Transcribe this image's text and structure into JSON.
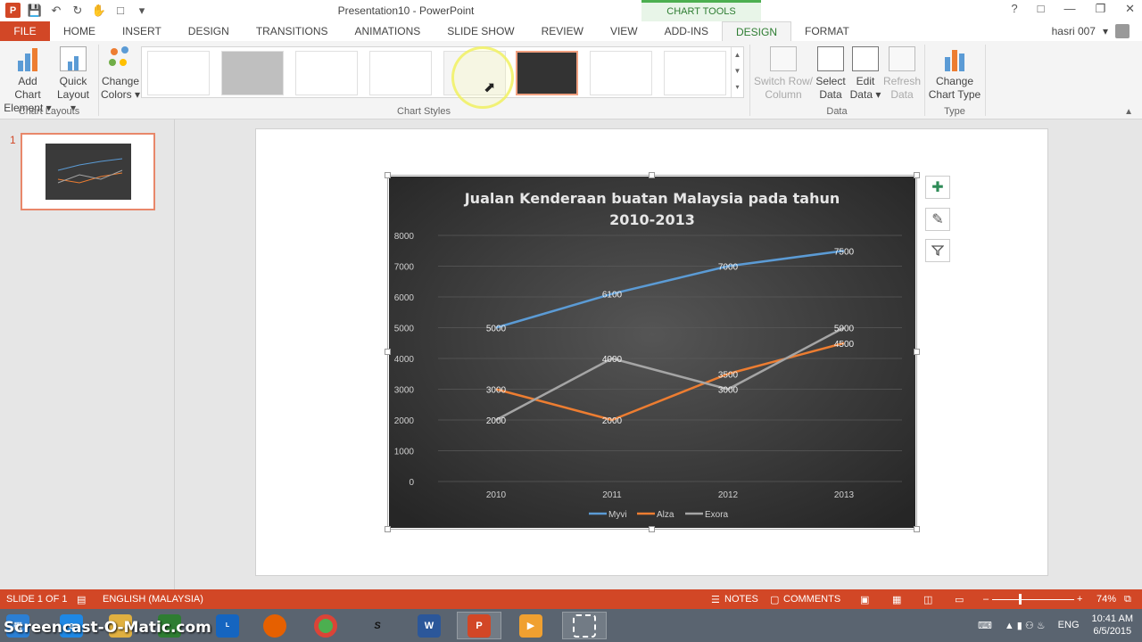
{
  "window": {
    "title": "Presentation10 - PowerPoint",
    "contextual_group": "CHART TOOLS",
    "help": "?"
  },
  "tabs": {
    "file": "FILE",
    "items": [
      "HOME",
      "INSERT",
      "DESIGN",
      "TRANSITIONS",
      "ANIMATIONS",
      "SLIDE SHOW",
      "REVIEW",
      "VIEW",
      "ADD-INS",
      "DESIGN",
      "FORMAT"
    ],
    "active_index": 9
  },
  "user": {
    "name": "hasri 007"
  },
  "ribbon": {
    "add_chart_element": [
      "Add Chart",
      "Element ▾"
    ],
    "quick_layout": [
      "Quick",
      "Layout ▾"
    ],
    "change_colors": [
      "Change",
      "Colors ▾"
    ],
    "switch_row_column": [
      "Switch Row/",
      "Column"
    ],
    "select_data": [
      "Select",
      "Data"
    ],
    "edit_data": [
      "Edit",
      "Data ▾"
    ],
    "refresh_data": [
      "Refresh",
      "Data"
    ],
    "change_chart_type": [
      "Change",
      "Chart Type"
    ],
    "groups": {
      "chart_layouts": "Chart Layouts",
      "chart_styles": "Chart Styles",
      "data": "Data",
      "type": "Type"
    }
  },
  "thumbnail_pane": {
    "slide_number": "1"
  },
  "chart_data": {
    "type": "line",
    "title": "Jualan Kenderaan buatan Malaysia pada tahun 2010-2013",
    "title_lines": [
      "Jualan Kenderaan buatan Malaysia pada tahun",
      "2010-2013"
    ],
    "categories": [
      "2010",
      "2011",
      "2012",
      "2013"
    ],
    "ylim": [
      0,
      8000
    ],
    "yticks": [
      "0",
      "1000",
      "2000",
      "3000",
      "4000",
      "5000",
      "6000",
      "7000",
      "8000"
    ],
    "grid": true,
    "legend_position": "bottom",
    "series": [
      {
        "name": "Myvi",
        "values": [
          5000,
          6100,
          7000,
          7500
        ],
        "color": "#5b9bd5",
        "labels": [
          "5000",
          "6100",
          "7000",
          "7500"
        ]
      },
      {
        "name": "Alza",
        "values": [
          3000,
          2000,
          3500,
          4500
        ],
        "color": "#ed7d31",
        "labels": [
          "3000",
          "2000",
          "3500",
          "4500"
        ]
      },
      {
        "name": "Exora",
        "values": [
          2000,
          4000,
          3000,
          5000
        ],
        "color": "#a5a5a5",
        "labels": [
          "2000",
          "4000",
          "3000",
          "5000"
        ]
      }
    ]
  },
  "status": {
    "slide": "SLIDE 1 OF 1",
    "language": "ENGLISH (MALAYSIA)",
    "notes": "NOTES",
    "comments": "COMMENTS",
    "zoom": "74%"
  },
  "taskbar": {
    "watermark": "Screencast-O-Matic.com",
    "language": "ENG",
    "time": "10:41 AM",
    "date": "6/5/2015"
  }
}
